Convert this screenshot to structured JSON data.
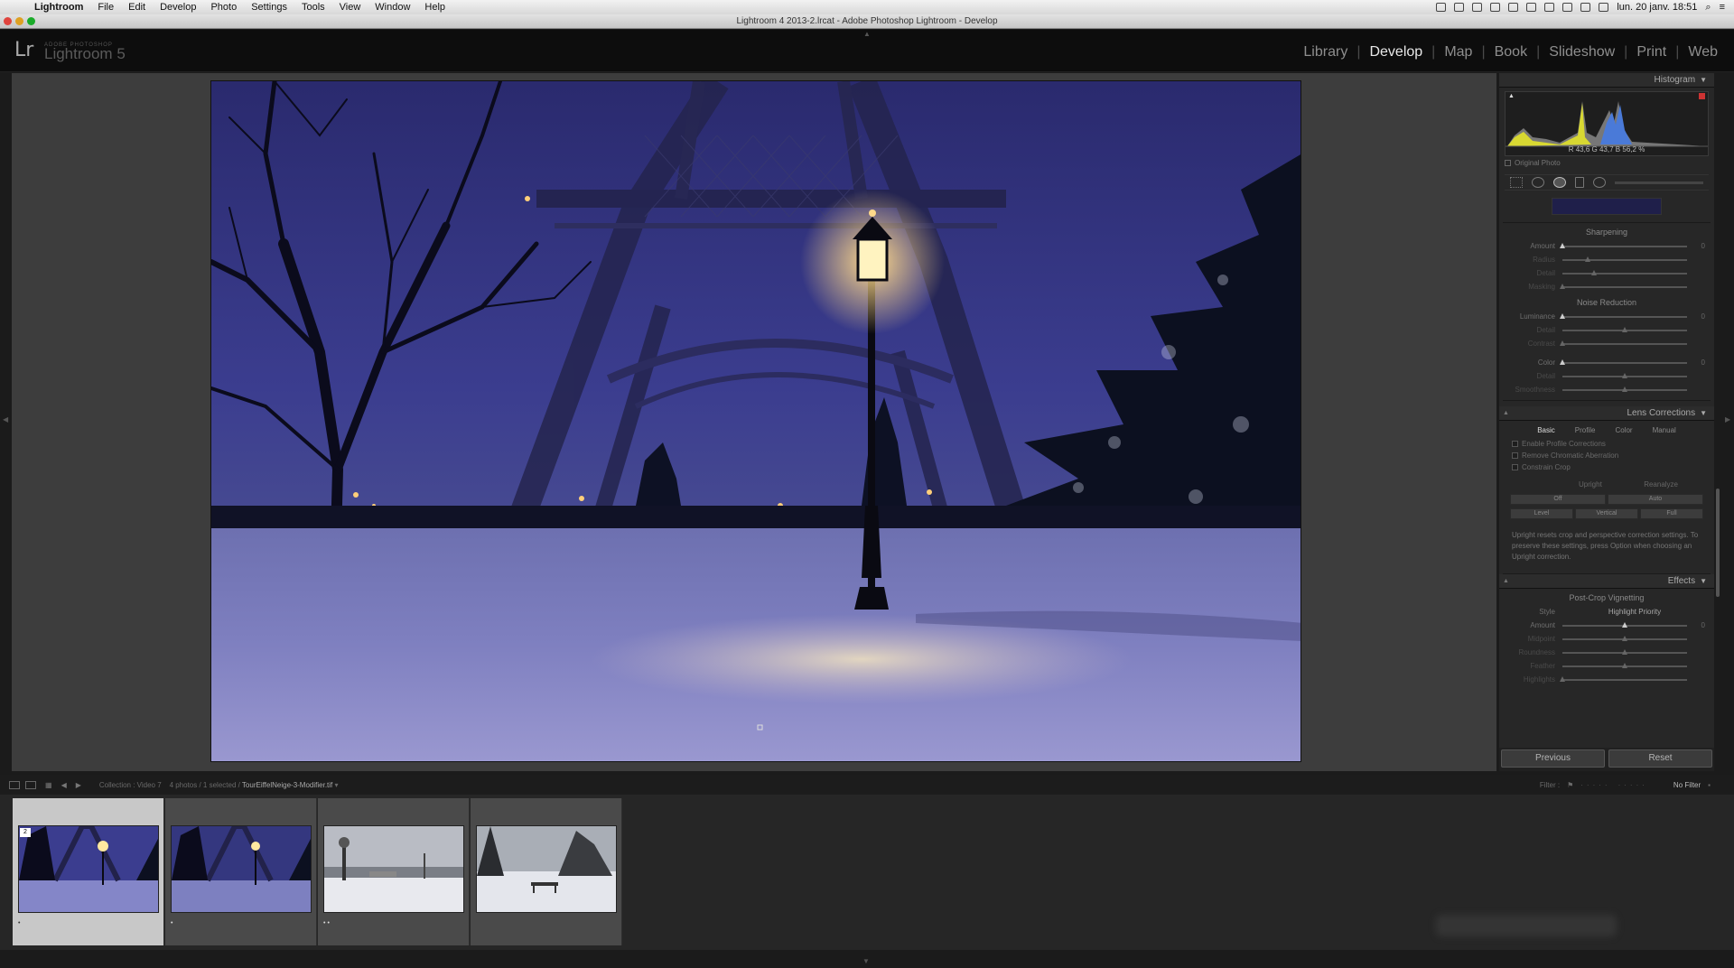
{
  "menubar": {
    "app": "Lightroom",
    "items": [
      "File",
      "Edit",
      "Develop",
      "Photo",
      "Settings",
      "Tools",
      "View",
      "Window",
      "Help"
    ],
    "clock": "lun. 20 janv.  18:51"
  },
  "window": {
    "title": "Lightroom 4 2013-2.lrcat - Adobe Photoshop Lightroom - Develop"
  },
  "identity": {
    "logo": "Lr",
    "sub": "ADOBE PHOTOSHOP",
    "name": "Lightroom 5"
  },
  "modules": [
    "Library",
    "Develop",
    "Map",
    "Book",
    "Slideshow",
    "Print",
    "Web"
  ],
  "active_module": "Develop",
  "histogram": {
    "title": "Histogram",
    "r_label": "R",
    "r": "43,6",
    "g_label": "G",
    "g": "43,7",
    "b_label": "B",
    "b": "56,2",
    "pct": "%",
    "original": "Original Photo"
  },
  "sharpening": {
    "title": "Sharpening",
    "sliders": [
      {
        "label": "Amount",
        "value": "0",
        "pos": 0.0,
        "dim": false
      },
      {
        "label": "Radius",
        "value": "",
        "pos": 0.2,
        "dim": true
      },
      {
        "label": "Detail",
        "value": "",
        "pos": 0.25,
        "dim": true
      },
      {
        "label": "Masking",
        "value": "",
        "pos": 0.0,
        "dim": true
      }
    ]
  },
  "noise": {
    "title": "Noise Reduction",
    "luminance": [
      {
        "label": "Luminance",
        "value": "0",
        "pos": 0.0,
        "dim": false
      },
      {
        "label": "Detail",
        "value": "",
        "pos": 0.5,
        "dim": true
      },
      {
        "label": "Contrast",
        "value": "",
        "pos": 0.0,
        "dim": true
      }
    ],
    "color": [
      {
        "label": "Color",
        "value": "0",
        "pos": 0.0,
        "dim": false
      },
      {
        "label": "Detail",
        "value": "",
        "pos": 0.5,
        "dim": true
      },
      {
        "label": "Smoothness",
        "value": "",
        "pos": 0.5,
        "dim": true
      }
    ]
  },
  "lens": {
    "title": "Lens Corrections",
    "tabs": [
      "Basic",
      "Profile",
      "Color",
      "Manual"
    ],
    "active_tab": "Basic",
    "checks": [
      "Enable Profile Corrections",
      "Remove Chromatic Aberration",
      "Constrain Crop"
    ],
    "upright_label": "Upright",
    "reanalyze": "Reanalyze",
    "upright_row1": [
      "Off",
      "Auto"
    ],
    "upright_row2": [
      "Level",
      "Vertical",
      "Full"
    ],
    "info": "Upright resets crop and perspective correction settings. To preserve these settings, press Option when choosing an Upright correction."
  },
  "effects": {
    "title": "Effects",
    "subtitle": "Post-Crop Vignetting",
    "style_label": "Style",
    "style_value": "Highlight Priority",
    "sliders": [
      {
        "label": "Amount",
        "value": "0",
        "pos": 0.5,
        "dim": false
      },
      {
        "label": "Midpoint",
        "value": "",
        "pos": 0.5,
        "dim": true
      },
      {
        "label": "Roundness",
        "value": "",
        "pos": 0.5,
        "dim": true
      },
      {
        "label": "Feather",
        "value": "",
        "pos": 0.5,
        "dim": true
      },
      {
        "label": "Highlights",
        "value": "",
        "pos": 0.0,
        "dim": true
      }
    ]
  },
  "panel_buttons": {
    "previous": "Previous",
    "reset": "Reset"
  },
  "filmstrip": {
    "collection": "Collection : Video 7",
    "count": "4 photos / 1 selected /",
    "file": "TourEiffelNeige-3-Modifier.tif",
    "filter_label": "Filter :",
    "filter_value": "No Filter",
    "selected_number": "2",
    "thumbs": [
      "eiffel-night",
      "eiffel-night-2",
      "snow-park-lamp",
      "snow-park-bench"
    ]
  },
  "colors": {
    "panel_bg": "#272727",
    "center_bg": "#3d3d3d",
    "active_module": "#e8e8e8",
    "inactive_module": "#8e8e8e"
  }
}
